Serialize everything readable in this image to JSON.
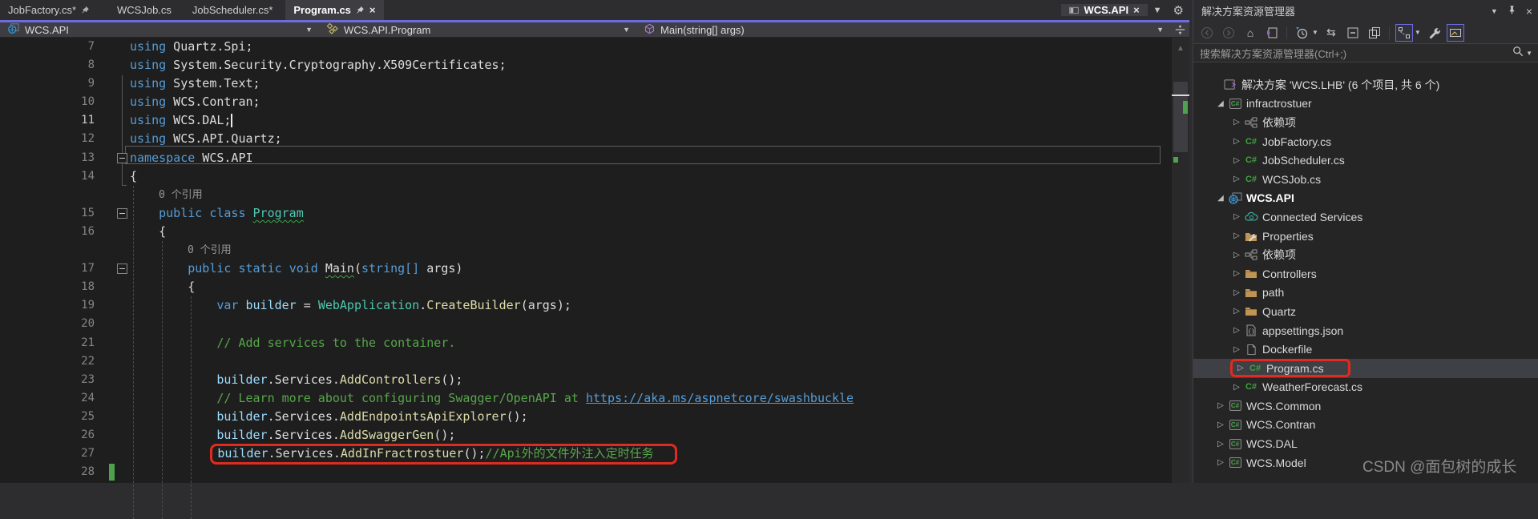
{
  "tabs": {
    "items": [
      {
        "label": "JobFactory.cs*",
        "pinned": true,
        "active": false
      },
      {
        "label": "WCSJob.cs",
        "pinned": false,
        "active": false
      },
      {
        "label": "JobScheduler.cs*",
        "pinned": false,
        "active": false
      },
      {
        "label": "Program.cs",
        "pinned": true,
        "active": true,
        "closable": true
      }
    ],
    "right_tab": {
      "label": "WCS.API",
      "closable": true
    }
  },
  "breadcrumb": {
    "project": "WCS.API",
    "type": "WCS.API.Program",
    "member": "Main(string[] args)"
  },
  "editor": {
    "codelens_label": "0 个引用",
    "lines": [
      {
        "num": "7",
        "segs": [
          [
            "k",
            "using"
          ],
          [
            "p",
            " Quartz.Spi;"
          ]
        ]
      },
      {
        "num": "8",
        "segs": [
          [
            "k",
            "using"
          ],
          [
            "p",
            " System.Security.Cryptography.X509Certificates;"
          ]
        ]
      },
      {
        "num": "9",
        "segs": [
          [
            "k",
            "using"
          ],
          [
            "p",
            " System.Text;"
          ]
        ]
      },
      {
        "num": "10",
        "segs": [
          [
            "k",
            "using"
          ],
          [
            "p",
            " WCS.Contran;"
          ]
        ]
      },
      {
        "num": "11",
        "current": true,
        "caret": true,
        "segs": [
          [
            "k",
            "using"
          ],
          [
            "p",
            " WCS.DAL;"
          ]
        ]
      },
      {
        "num": "12",
        "segs": [
          [
            "k",
            "using"
          ],
          [
            "p",
            " WCS.API.Quartz;"
          ]
        ]
      },
      {
        "num": "13",
        "fold": true,
        "segs": [
          [
            "k",
            "namespace"
          ],
          [
            "p",
            " WCS.API"
          ]
        ]
      },
      {
        "num": "14",
        "segs": [
          [
            "p",
            "{"
          ]
        ]
      },
      {
        "lens": "0 个引用",
        "lensx": 198
      },
      {
        "num": "15",
        "fold": true,
        "segs": [
          [
            "p",
            "    "
          ],
          [
            "k",
            "public"
          ],
          [
            "p",
            " "
          ],
          [
            "k",
            "class"
          ],
          [
            "p",
            " "
          ],
          [
            "cw",
            "Program"
          ]
        ]
      },
      {
        "num": "16",
        "segs": [
          [
            "p",
            "    {"
          ]
        ]
      },
      {
        "lens": "0 个引用",
        "lensx": 234
      },
      {
        "num": "17",
        "fold": true,
        "segs": [
          [
            "p",
            "        "
          ],
          [
            "k",
            "public"
          ],
          [
            "p",
            " "
          ],
          [
            "k",
            "static"
          ],
          [
            "p",
            " "
          ],
          [
            "k",
            "void"
          ],
          [
            "p",
            " "
          ],
          [
            "mw",
            "Main"
          ],
          [
            "p",
            "("
          ],
          [
            "k",
            "string[]"
          ],
          [
            "p",
            " args)"
          ]
        ]
      },
      {
        "num": "18",
        "segs": [
          [
            "p",
            "        {"
          ]
        ]
      },
      {
        "num": "19",
        "segs": [
          [
            "p",
            "            "
          ],
          [
            "k",
            "var"
          ],
          [
            "p",
            " "
          ],
          [
            "v",
            "builder"
          ],
          [
            "p",
            " = "
          ],
          [
            "t",
            "WebApplication"
          ],
          [
            "p",
            "."
          ],
          [
            "m",
            "CreateBuilder"
          ],
          [
            "p",
            "(args);"
          ]
        ]
      },
      {
        "num": "20",
        "segs": []
      },
      {
        "num": "21",
        "segs": [
          [
            "p",
            "            "
          ],
          [
            "c",
            "// Add services to the container."
          ]
        ]
      },
      {
        "num": "22",
        "segs": []
      },
      {
        "num": "23",
        "segs": [
          [
            "p",
            "            "
          ],
          [
            "v",
            "builder"
          ],
          [
            "p",
            ".Services."
          ],
          [
            "m",
            "AddControllers"
          ],
          [
            "p",
            "();"
          ]
        ]
      },
      {
        "num": "24",
        "segs": [
          [
            "p",
            "            "
          ],
          [
            "c",
            "// Learn more about configuring Swagger/OpenAPI at "
          ],
          [
            "cl-link",
            "https://aka.ms/aspnetcore/swashbuckle"
          ]
        ]
      },
      {
        "num": "25",
        "segs": [
          [
            "p",
            "            "
          ],
          [
            "v",
            "builder"
          ],
          [
            "p",
            ".Services."
          ],
          [
            "m",
            "AddEndpointsApiExplorer"
          ],
          [
            "p",
            "();"
          ]
        ]
      },
      {
        "num": "26",
        "segs": [
          [
            "p",
            "            "
          ],
          [
            "v",
            "builder"
          ],
          [
            "p",
            ".Services."
          ],
          [
            "m",
            "AddSwaggerGen"
          ],
          [
            "p",
            "();"
          ]
        ]
      },
      {
        "num": "27",
        "redbox": true,
        "segs": [
          [
            "p",
            "            "
          ],
          [
            "v",
            "builder"
          ],
          [
            "p",
            ".Services."
          ],
          [
            "m",
            "AddInFractrostuer"
          ],
          [
            "p",
            "();"
          ],
          [
            "c",
            "//Api外的文件外注入定时任务"
          ]
        ]
      },
      {
        "num": "28",
        "change": true,
        "segs": []
      }
    ]
  },
  "solution_explorer": {
    "title": "解决方案资源管理器",
    "search_placeholder": "搜索解决方案资源管理器(Ctrl+;)",
    "tree": [
      {
        "label": "解决方案 'WCS.LHB' (6 个项目, 共 6 个)",
        "icon": "sln",
        "indent": 0,
        "arrow": null
      },
      {
        "label": "infractrostuer",
        "icon": "csproj",
        "indent": 1,
        "arrow": "exp"
      },
      {
        "label": "依赖项",
        "icon": "dep",
        "indent": 2,
        "arrow": "col"
      },
      {
        "label": "JobFactory.cs",
        "icon": "cs",
        "indent": 2,
        "arrow": "col"
      },
      {
        "label": "JobScheduler.cs",
        "icon": "cs",
        "indent": 2,
        "arrow": "col"
      },
      {
        "label": "WCSJob.cs",
        "icon": "cs",
        "indent": 2,
        "arrow": "col"
      },
      {
        "label": "WCS.API",
        "icon": "web",
        "indent": 1,
        "arrow": "exp",
        "bold": true
      },
      {
        "label": "Connected Services",
        "icon": "cloud",
        "indent": 2,
        "arrow": "col"
      },
      {
        "label": "Properties",
        "icon": "props",
        "indent": 2,
        "arrow": "col"
      },
      {
        "label": "依赖项",
        "icon": "dep",
        "indent": 2,
        "arrow": "col"
      },
      {
        "label": "Controllers",
        "icon": "folder",
        "indent": 2,
        "arrow": "col"
      },
      {
        "label": "path",
        "icon": "folder",
        "indent": 2,
        "arrow": "col"
      },
      {
        "label": "Quartz",
        "icon": "folder",
        "indent": 2,
        "arrow": "col"
      },
      {
        "label": "appsettings.json",
        "icon": "json",
        "indent": 2,
        "arrow": "col"
      },
      {
        "label": "Dockerfile",
        "icon": "file",
        "indent": 2,
        "arrow": "col"
      },
      {
        "label": "Program.cs",
        "icon": "cs",
        "indent": 2,
        "arrow": "col",
        "selected": true,
        "redbox": true
      },
      {
        "label": "WeatherForecast.cs",
        "icon": "cs",
        "indent": 2,
        "arrow": "col"
      },
      {
        "label": "WCS.Common",
        "icon": "csproj",
        "indent": 1,
        "arrow": "col"
      },
      {
        "label": "WCS.Contran",
        "icon": "csproj",
        "indent": 1,
        "arrow": "col"
      },
      {
        "label": "WCS.DAL",
        "icon": "csproj",
        "indent": 1,
        "arrow": "col"
      },
      {
        "label": "WCS.Model",
        "icon": "csproj",
        "indent": 1,
        "arrow": "col"
      }
    ]
  },
  "watermark": "CSDN @面包树的成长",
  "colors": {
    "accent_purple": "#6C6CDC",
    "editor_bg": "#1E1E1E",
    "chrome_bg": "#2D2D30",
    "annotation_red": "#E02B20",
    "change_green": "#4EA24E"
  }
}
